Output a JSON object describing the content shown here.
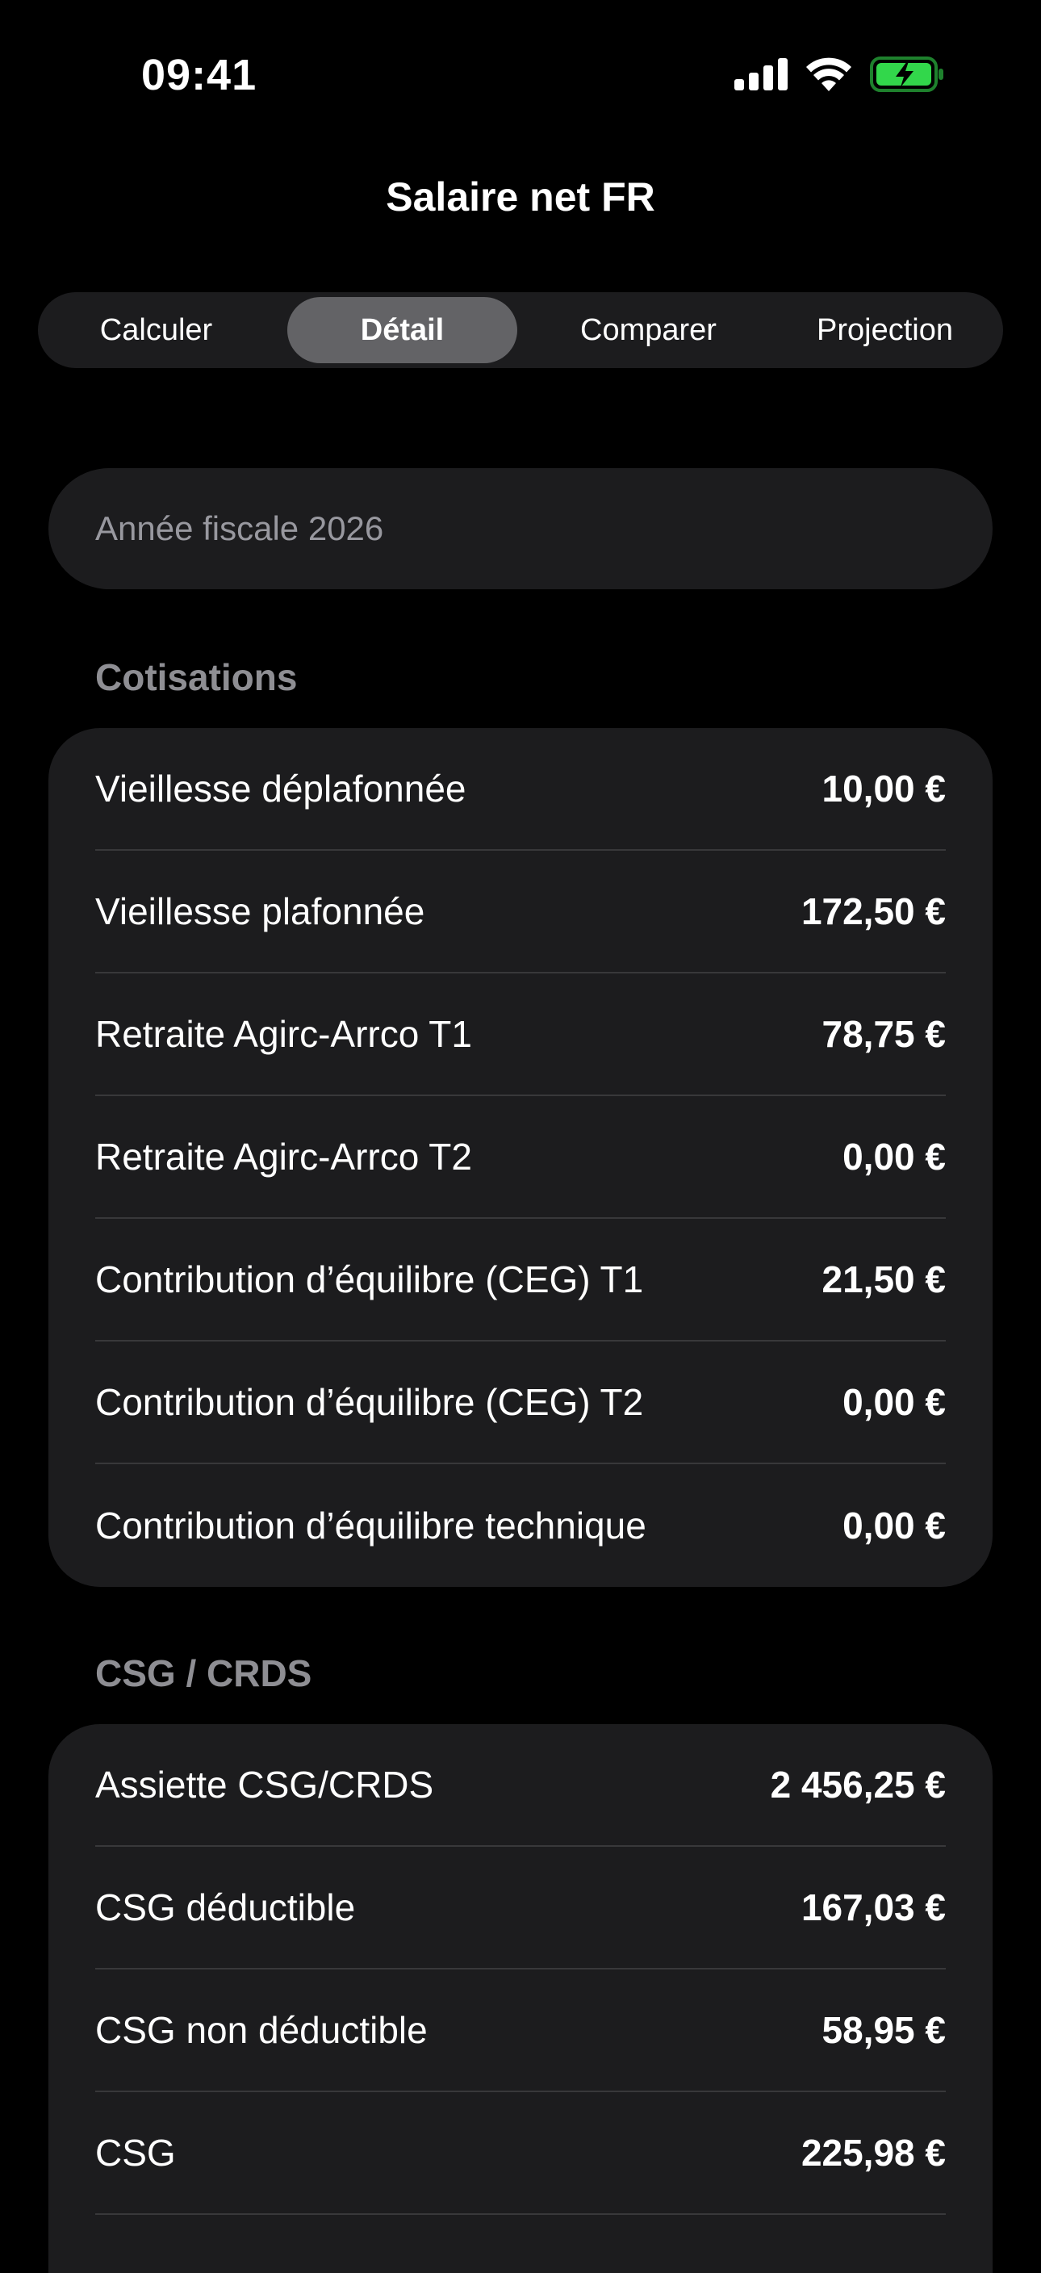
{
  "status_bar": {
    "time": "09:41",
    "icons": [
      "cellular-signal-icon",
      "wifi-icon",
      "battery-charging-icon"
    ],
    "battery_color": "#32d74b"
  },
  "nav": {
    "title": "Salaire net FR"
  },
  "tabs": [
    {
      "label": "Calculer",
      "selected": false
    },
    {
      "label": "Détail",
      "selected": true
    },
    {
      "label": "Comparer",
      "selected": false
    },
    {
      "label": "Projection",
      "selected": false
    }
  ],
  "fiscal_year": {
    "label": "Année fiscale 2026"
  },
  "sections": {
    "cotisations": {
      "title": "Cotisations",
      "rows": [
        {
          "label": "Vieillesse déplafonnée",
          "value": "10,00 €"
        },
        {
          "label": "Vieillesse plafonnée",
          "value": "172,50 €"
        },
        {
          "label": "Retraite Agirc-Arrco T1",
          "value": "78,75 €"
        },
        {
          "label": "Retraite Agirc-Arrco T2",
          "value": "0,00 €"
        },
        {
          "label": "Contribution d’équilibre (CEG) T1",
          "value": "21,50 €"
        },
        {
          "label": "Contribution d’équilibre (CEG) T2",
          "value": "0,00 €"
        },
        {
          "label": "Contribution d’équilibre technique",
          "value": "0,00 €"
        }
      ]
    },
    "csg_crds": {
      "title": "CSG / CRDS",
      "rows": [
        {
          "label": "Assiette CSG/CRDS",
          "value": "2 456,25 €"
        },
        {
          "label": "CSG déductible",
          "value": "167,03 €"
        },
        {
          "label": "CSG non déductible",
          "value": "58,95 €"
        },
        {
          "label": "CSG",
          "value": "225,98 €"
        }
      ]
    }
  },
  "colors": {
    "background": "#000000",
    "card": "#1c1c1e",
    "selected_segment": "#636366",
    "secondary_text": "#8e8e93",
    "separator": "#38383a"
  }
}
